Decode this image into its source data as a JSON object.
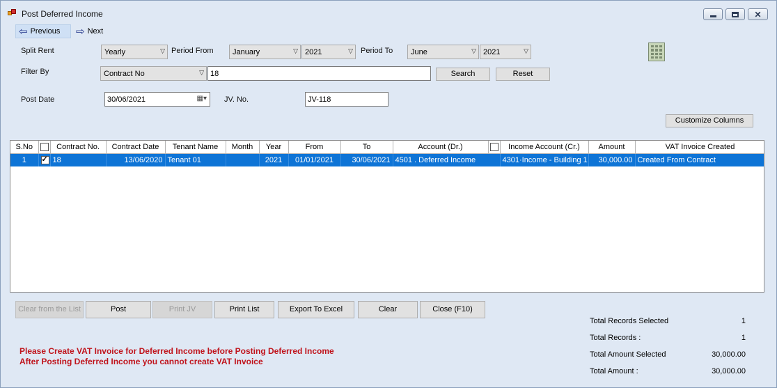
{
  "window": {
    "title": "Post Deferred Income"
  },
  "nav": {
    "previous": "Previous",
    "next": "Next"
  },
  "filters": {
    "split_rent_label": "Split Rent",
    "split_rent_value": "Yearly",
    "period_from_label": "Period From",
    "period_from_month": "January",
    "period_from_year": "2021",
    "period_to_label": "Period To",
    "period_to_month": "June",
    "period_to_year": "2021",
    "filter_by_label": "Filter By",
    "filter_by_value": "Contract No",
    "filter_text": "18",
    "search_label": "Search",
    "reset_label": "Reset",
    "post_date_label": "Post Date",
    "post_date_value": "30/06/2021",
    "jv_no_label": "JV. No.",
    "jv_no_value": "JV-118",
    "customize_columns_label": "Customize Columns"
  },
  "table": {
    "columns": [
      "S.No",
      "",
      "Contract No.",
      "Contract Date",
      "Tenant Name",
      "Month",
      "Year",
      "From",
      "To",
      "Account  (Dr.)",
      "",
      "Income Account (Cr.)",
      "Amount",
      "VAT Invoice Created"
    ],
    "rows": [
      {
        "sno": "1",
        "checked": true,
        "contract_no": "18",
        "contract_date": "13/06/2020",
        "tenant_name": "Tenant 01",
        "month": "",
        "year": "2021",
        "from": "01/01/2021",
        "to": "30/06/2021",
        "account_dr": "4501 . Deferred Income",
        "income_account_cr": "4301·Income - Building 1",
        "amount": "30,000.00",
        "vat_invoice": "Created From Contract"
      }
    ]
  },
  "actions": {
    "clear_from_list": "Clear from the List",
    "post": "Post",
    "print_jv": "Print JV",
    "print_list": "Print List",
    "export_excel": "Export To Excel",
    "clear": "Clear",
    "close": "Close (F10)"
  },
  "summary": {
    "total_records_selected_label": "Total Records  Selected",
    "total_records_selected": "1",
    "total_records_label": "Total Records :",
    "total_records": "1",
    "total_amount_selected_label": "Total Amount Selected",
    "total_amount_selected": "30,000.00",
    "total_amount_label": "Total Amount :",
    "total_amount": "30,000.00"
  },
  "warnings": {
    "line1": "Please Create VAT Invoice for Deferred Income before Posting Deferred Income",
    "line2": "After Posting Deferred Income you cannot create VAT Invoice"
  },
  "colors": {
    "selection": "#0e74d6",
    "warning": "#c0141c",
    "window_bg": "#dfe8f4"
  }
}
